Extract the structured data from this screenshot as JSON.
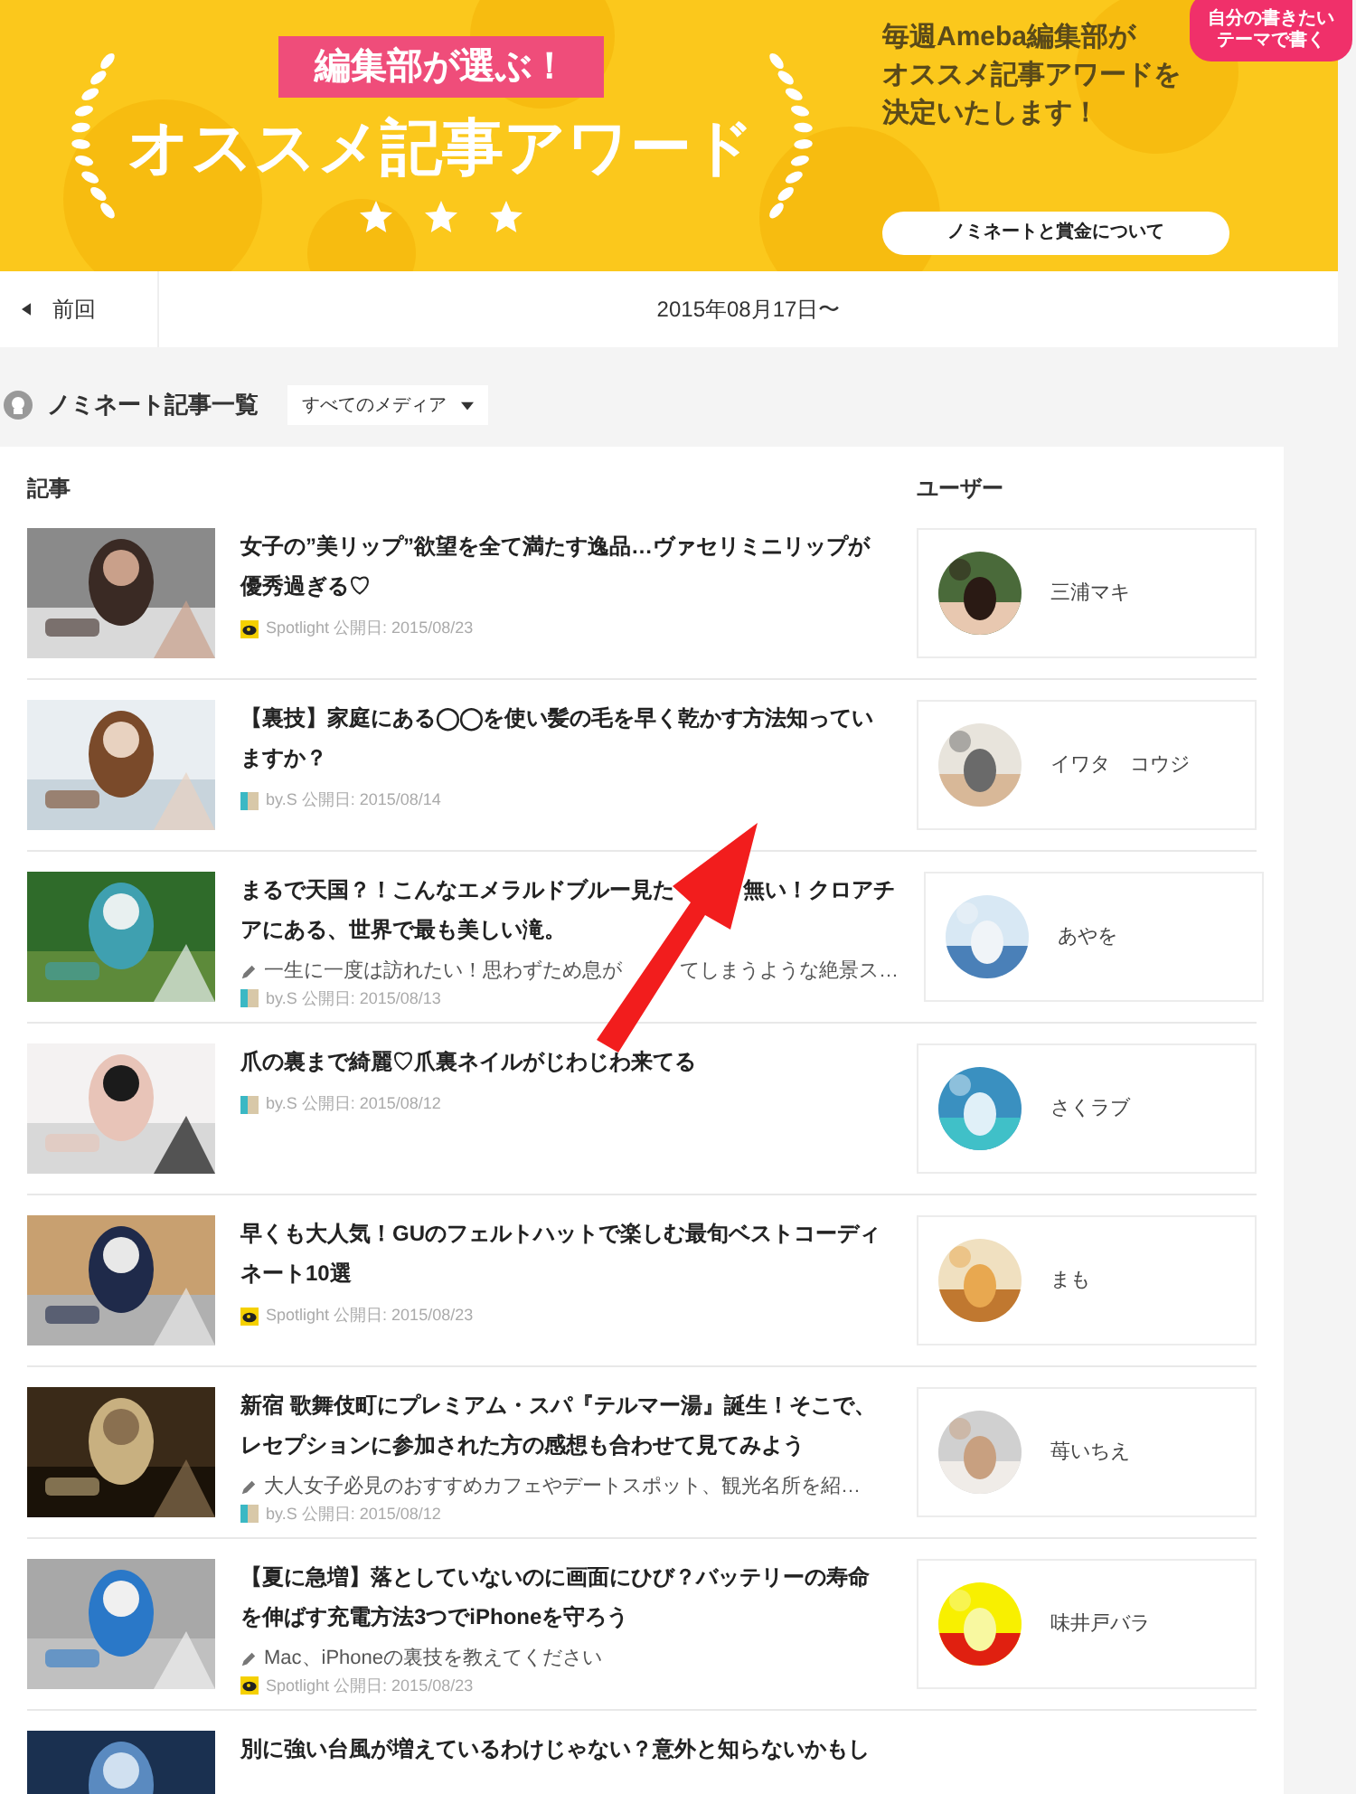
{
  "banner": {
    "ribbon": "編集部が選ぶ！",
    "title": "オススメ記事アワード",
    "stars": 3,
    "tagline_lines": [
      "毎週Ameba編集部が",
      "オススメ記事アワードを",
      "決定いたします！"
    ],
    "button": "ノミネートと賞金について",
    "corner_button": "自分の書きたいテーマで書く"
  },
  "nav": {
    "prev": "前回",
    "period": "2015年08月17日〜"
  },
  "section": {
    "title": "ノミネート記事一覧",
    "filter": "すべてのメディア"
  },
  "table": {
    "columns": [
      "記事",
      "ユーザー"
    ],
    "rows": [
      {
        "title": "女子の”美リップ”欲望を全て満たす逸品…ヴァセリミニリップが優秀過ぎる♡",
        "kind": "spotlight",
        "source": "Spotlight",
        "date": "公開日: 2015/08/23",
        "user": "三浦マキ"
      },
      {
        "title": "【裏技】家庭にある◯◯を使い髪の毛を早く乾かす方法知っていますか？",
        "kind": "bys",
        "source": "by.S",
        "date": "公開日: 2015/08/14",
        "user": "イワタ　コウジ"
      },
      {
        "title_parts": [
          "まるで天国？！こんなエメラルドブルー見た",
          "無い！クロアチ",
          "アにある、世界で最も美しい滝。"
        ],
        "summary_parts": [
          "一生に一度は訪れたい！思わずため息が",
          "てしまうような絶景ス…"
        ],
        "kind": "bys",
        "source": "by.S",
        "date": "公開日: 2015/08/13",
        "user": "あやを"
      },
      {
        "title": "爪の裏まで綺麗♡爪裏ネイルがじわじわ来てる",
        "kind": "bys",
        "source": "by.S",
        "date": "公開日: 2015/08/12",
        "user": "さくラブ"
      },
      {
        "title": "早くも大人気！GUのフェルトハットで楽しむ最旬ベストコーディネート10選",
        "kind": "spotlight",
        "source": "Spotlight",
        "date": "公開日: 2015/08/23",
        "user": "まも"
      },
      {
        "title": "新宿 歌舞伎町にプレミアム・スパ『テルマー湯』誕生！そこで、レセプションに参加された方の感想も合わせて見てみよう",
        "summary": "大人女子必見のおすすめカフェやデートスポット、観光名所を紹…",
        "kind": "bys",
        "source": "by.S",
        "date": "公開日: 2015/08/12",
        "user": "苺いちえ"
      },
      {
        "title": "【夏に急増】落としていないのに画面にひび？バッテリーの寿命を伸ばす充電方法3つでiPhoneを守ろう",
        "summary": "Mac、iPhoneの裏技を教えてください",
        "kind": "spotlight",
        "source": "Spotlight",
        "date": "公開日: 2015/08/23",
        "user": "味井戸バラ"
      },
      {
        "title": "別に強い台風が増えているわけじゃない？意外と知らないかもし"
      }
    ]
  }
}
